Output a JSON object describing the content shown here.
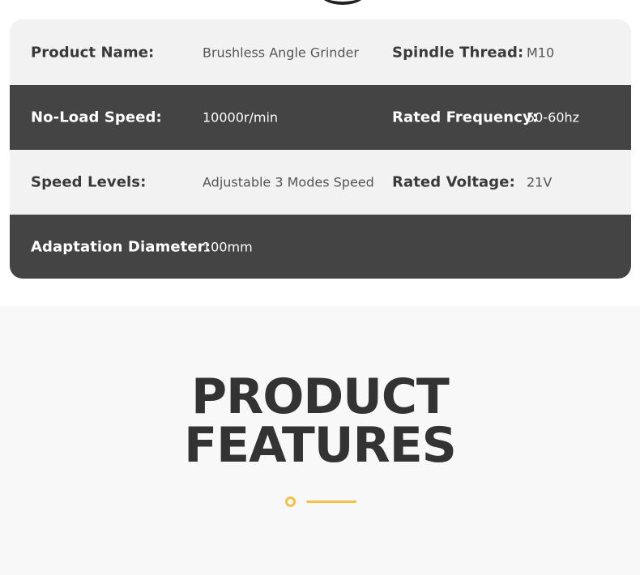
{
  "specs": {
    "rows": [
      {
        "label1": "Product Name:",
        "value1": "Brushless Angle Grinder",
        "label2": "Spindle Thread:",
        "value2": "M10"
      },
      {
        "label1": "No-Load Speed:",
        "value1": "10000r/min",
        "label2": "Rated Frequency:",
        "value2": "50-60hz"
      },
      {
        "label1": "Speed Levels:",
        "value1": "Adjustable 3 Modes Speed",
        "label2": "Rated Voltage:",
        "value2": "21V"
      },
      {
        "label1": "Adaptation Diameter:",
        "value1": "100mm"
      }
    ]
  },
  "features": {
    "title_line1": "PRODUCT",
    "title_line2": "FEATURES"
  },
  "colors": {
    "dark_row": "#444444",
    "light_row": "#f2f2f2",
    "accent": "#f0c24b",
    "title": "#333333"
  }
}
